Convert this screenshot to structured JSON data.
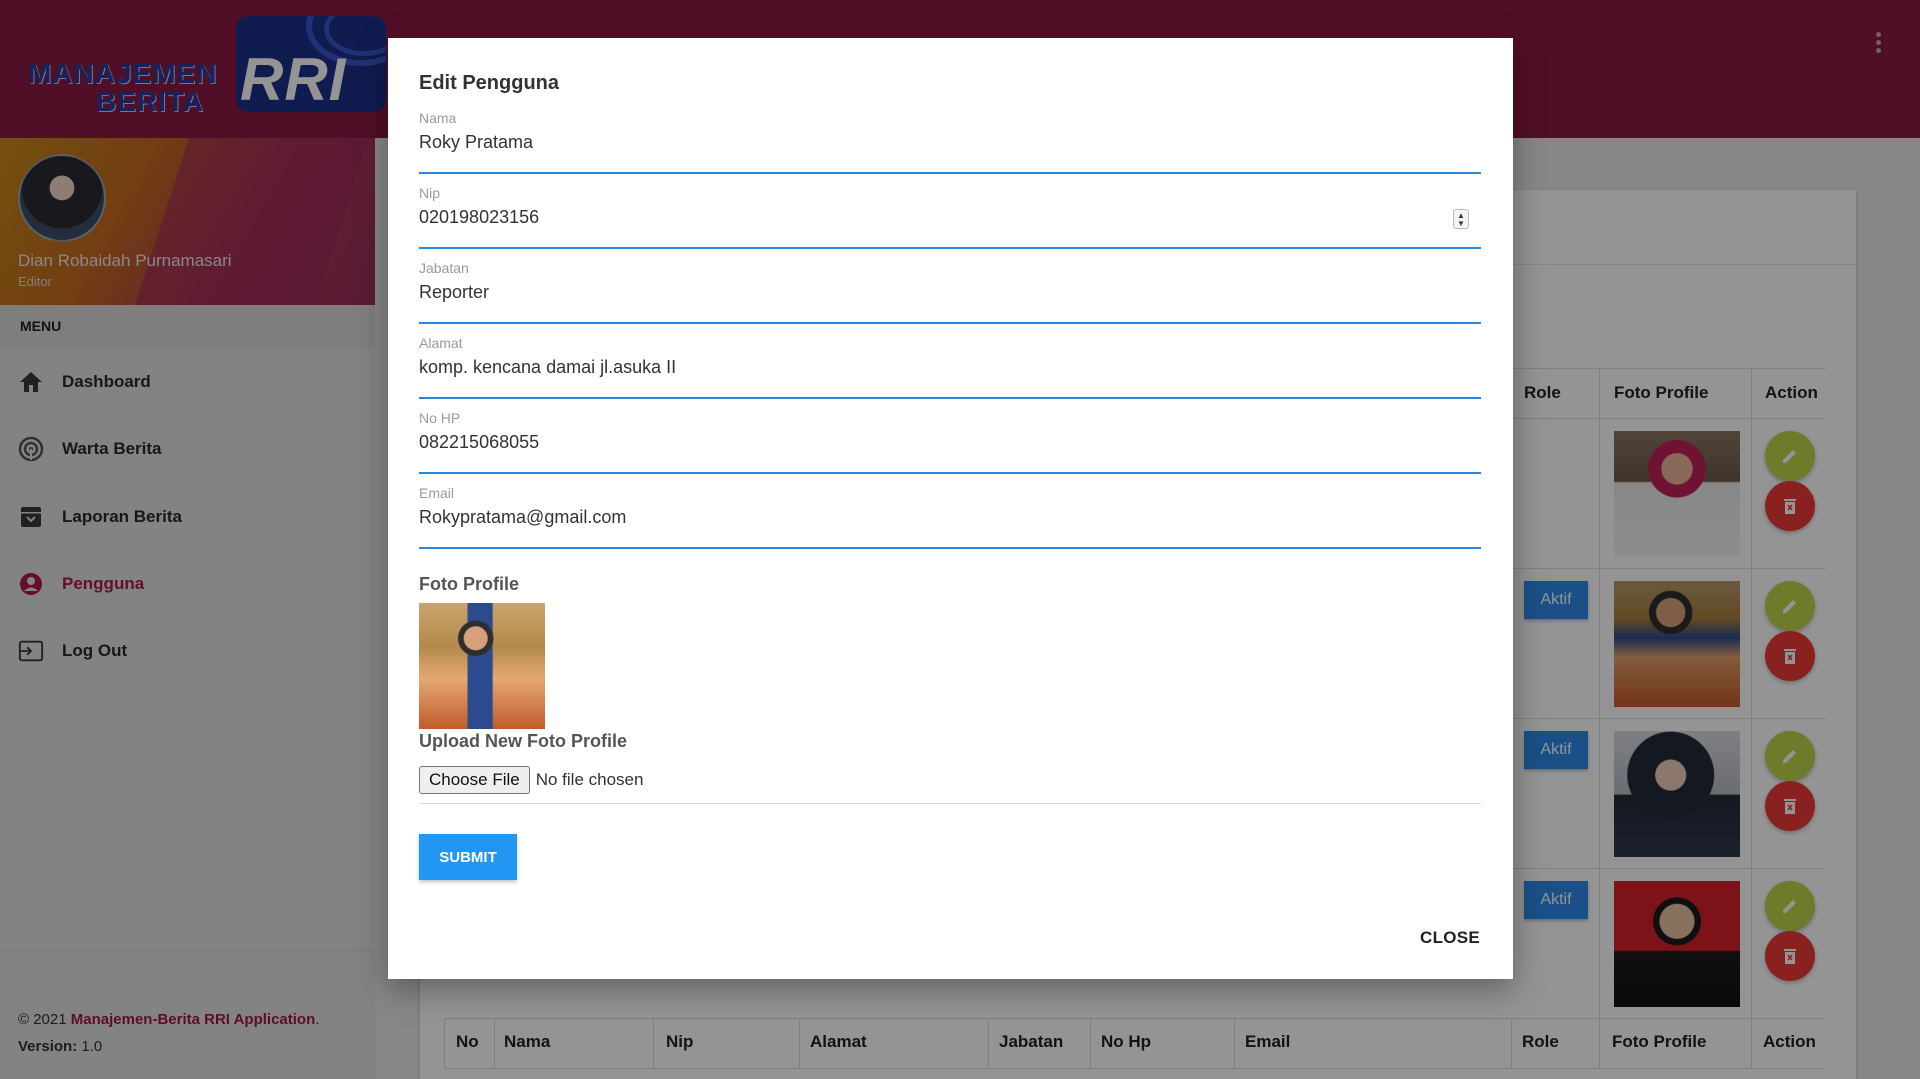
{
  "header": {
    "logo_line1": "MANAJEMEN",
    "logo_line2": "BERITA",
    "logo_mark": "RRI",
    "menu_icon": "kebab-menu-icon"
  },
  "sidebar": {
    "user_name": "Dian Robaidah Purnamasari",
    "user_role": "Editor",
    "menu_label": "MENU",
    "items": [
      {
        "label": "Dashboard",
        "icon": "home-icon"
      },
      {
        "label": "Warta Berita",
        "icon": "broadcast-icon"
      },
      {
        "label": "Laporan Berita",
        "icon": "archive-icon"
      },
      {
        "label": "Pengguna",
        "icon": "account-icon",
        "active": true
      },
      {
        "label": "Log Out",
        "icon": "logout-icon"
      }
    ],
    "footer_prefix": "© 2021",
    "footer_brand": "Manajemen-Berita RRI Application",
    "footer_suffix": ".",
    "version_label": "Version:",
    "version_value": "1.0"
  },
  "table": {
    "top_headers": {
      "role": "Role",
      "foto": "Foto Profile",
      "action": "Action"
    },
    "bottom_headers": [
      "No",
      "Nama",
      "Nip",
      "Alamat",
      "Jabatan",
      "No Hp",
      "Email",
      "Role",
      "Foto Profile",
      "Action"
    ],
    "rows": [
      {
        "role": ""
      },
      {
        "role": "Aktif"
      },
      {
        "role": "Aktif"
      },
      {
        "role": "Aktif"
      }
    ]
  },
  "modal": {
    "title": "Edit Pengguna",
    "fields": [
      {
        "label": "Nama",
        "value": "Roky Pratama"
      },
      {
        "label": "Nip",
        "value": "020198023156"
      },
      {
        "label": "Jabatan",
        "value": "Reporter"
      },
      {
        "label": "Alamat",
        "value": "komp. kencana damai jl.asuka II"
      },
      {
        "label": "No HP",
        "value": "082215068055"
      },
      {
        "label": "Email",
        "value": "Rokypratama@gmail.com"
      }
    ],
    "foto_label": "Foto Profile",
    "upload_label": "Upload New Foto Profile",
    "choose_file": "Choose File",
    "no_file": "No file chosen",
    "submit": "SUBMIT",
    "close": "CLOSE"
  },
  "colors": {
    "header_bg": "#8c1a44",
    "accent_active": "#b0174f",
    "input_underline": "#2b86dd",
    "submit_bg": "#2196f3",
    "edit_btn": "#bcd44a",
    "delete_btn": "#ec3a3a"
  }
}
